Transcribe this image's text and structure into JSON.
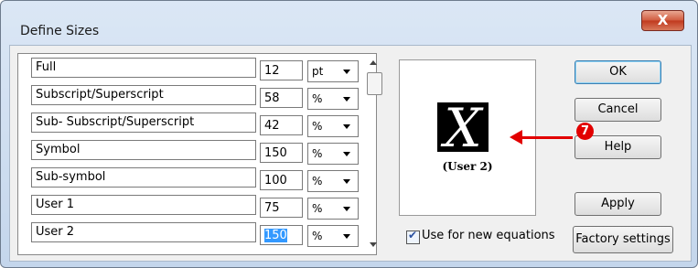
{
  "window": {
    "title": "Define Sizes",
    "close_glyph": "X"
  },
  "rows": [
    {
      "label": "Full",
      "value": "12",
      "unit": "pt"
    },
    {
      "label": "Subscript/Superscript",
      "value": "58",
      "unit": "%"
    },
    {
      "label": "Sub- Subscript/Superscript",
      "value": "42",
      "unit": "%"
    },
    {
      "label": "Symbol",
      "value": "150",
      "unit": "%"
    },
    {
      "label": "Sub-symbol",
      "value": "100",
      "unit": "%"
    },
    {
      "label": "User 1",
      "value": "75",
      "unit": "%"
    },
    {
      "label": "User 2",
      "value": "150",
      "unit": "%"
    }
  ],
  "preview": {
    "glyph": "X",
    "caption": "(User 2)"
  },
  "checkbox": {
    "label": "Use for new equations",
    "checked": true
  },
  "buttons": {
    "ok": "OK",
    "cancel": "Cancel",
    "help": "Help",
    "apply": "Apply",
    "factory": "Factory settings"
  },
  "annotation": {
    "step_number": "7",
    "color": "#e20000"
  }
}
